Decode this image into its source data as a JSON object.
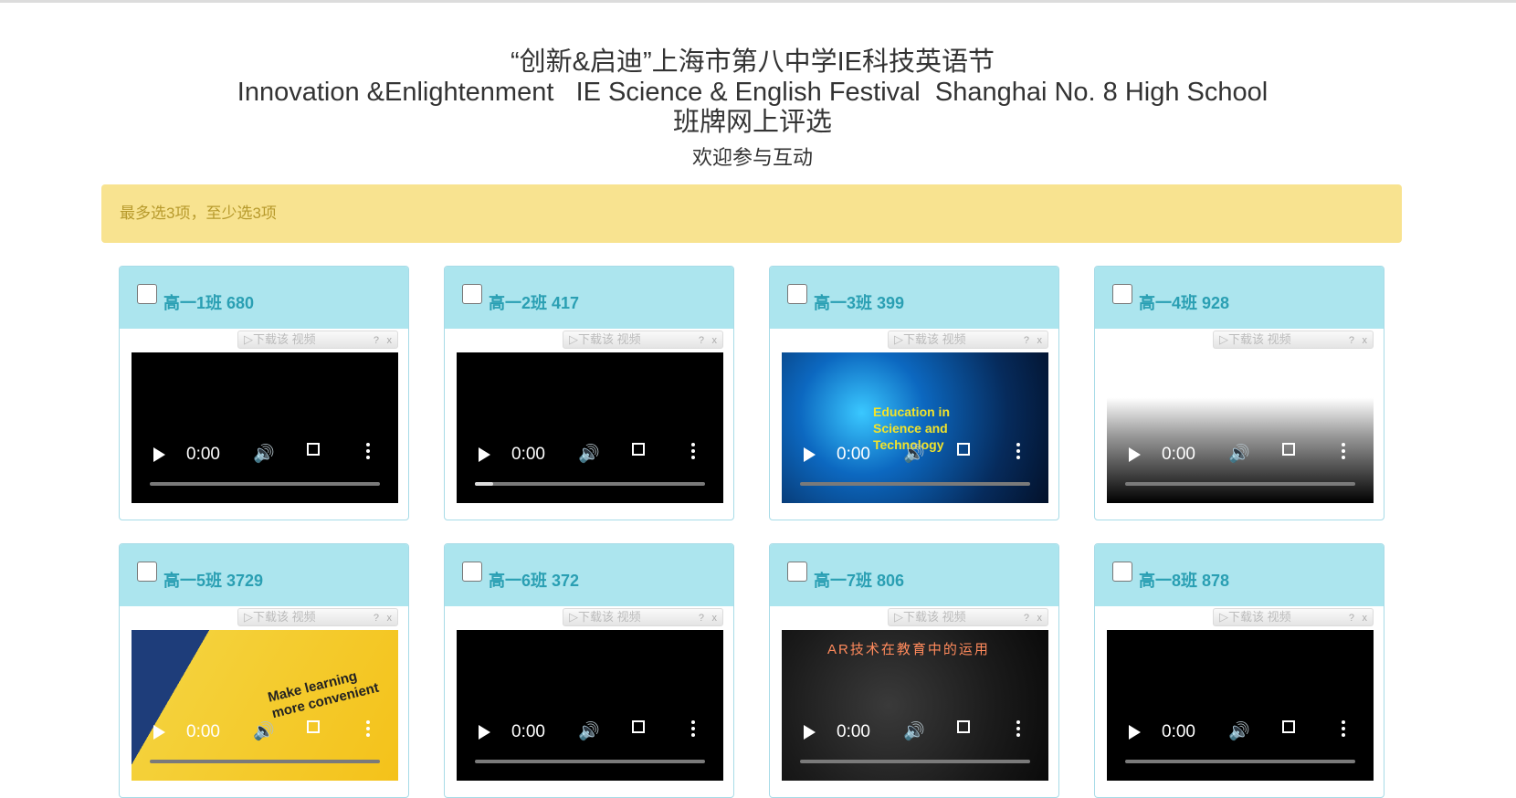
{
  "header": {
    "title_cn": "“创新&启迪”上海市第八中学IE科技英语节",
    "title_en": "Innovation &Enlightenment   IE Science & English Festival  Shanghai No. 8 High School",
    "subtitle": "班牌网上评选",
    "welcome": "欢迎参与互动"
  },
  "alert": {
    "text": "最多选3项，至少选3项"
  },
  "download_bar": {
    "label": "▷下载该 视频",
    "help": "?",
    "close": "x"
  },
  "cards": [
    {
      "title": "高一1班 680",
      "time": "0:00",
      "poster": "black",
      "progress": 0.0
    },
    {
      "title": "高一2班 417",
      "time": "0:00",
      "poster": "black",
      "progress": 0.08
    },
    {
      "title": "高一3班 399",
      "time": "0:00",
      "poster": "globe",
      "overlay": "Education in\nScience and\nTechnology",
      "progress": 0.0
    },
    {
      "title": "高一4班 928",
      "time": "0:00",
      "poster": "fade",
      "progress": 0.0
    },
    {
      "title": "高一5班 3729",
      "time": "0:00",
      "poster": "comic",
      "overlay": "Make learning more convenient",
      "progress": 0.0
    },
    {
      "title": "高一6班 372",
      "time": "0:00",
      "poster": "black",
      "progress": 0.0
    },
    {
      "title": "高一7班 806",
      "time": "0:00",
      "poster": "ar",
      "overlay": "AR技术在教育中的运用",
      "progress": 0.0
    },
    {
      "title": "高一8班 878",
      "time": "0:00",
      "poster": "black",
      "progress": 0.0
    }
  ]
}
